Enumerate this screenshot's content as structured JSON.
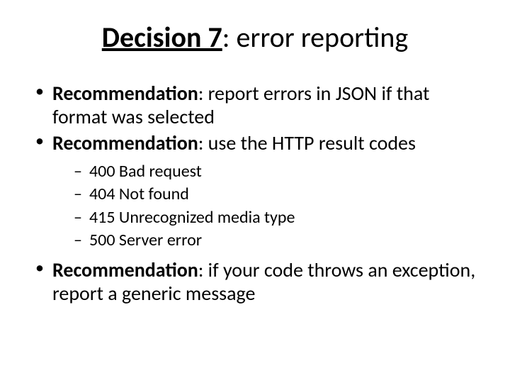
{
  "title": {
    "strong": "Decision 7",
    "rest": ": error reporting"
  },
  "items": [
    {
      "label": "Recommendation",
      "text": ": report errors in JSON if that format was selected"
    },
    {
      "label": "Recommendation",
      "text": ": use the HTTP result codes",
      "sub": [
        "400 Bad request",
        "404 Not found",
        "415 Unrecognized media type",
        "500 Server error"
      ]
    },
    {
      "label": "Recommendation",
      "text": ": if your code throws an exception, report a generic message"
    }
  ]
}
